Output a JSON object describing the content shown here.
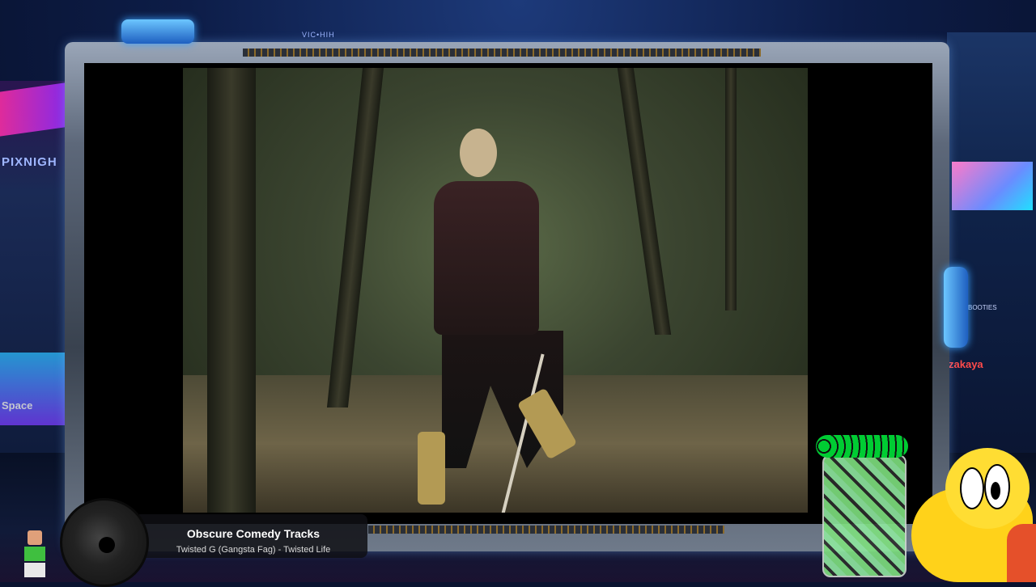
{
  "background": {
    "sign_left": "PIXNIGH",
    "sign_left_box": "Space",
    "sign_top": "VIC•HIH",
    "sign_right_shop": "zakaya",
    "sign_right_small": "BOOTIES"
  },
  "now_playing": {
    "title": "Obscure Comedy Tracks",
    "track": "Twisted G (Gangsta Fag) - Twisted Life"
  },
  "colors": {
    "frame_glow": "#3aa0ff",
    "neon_pink": "#ff2ea8",
    "koopa_yellow": "#ffdd33"
  }
}
